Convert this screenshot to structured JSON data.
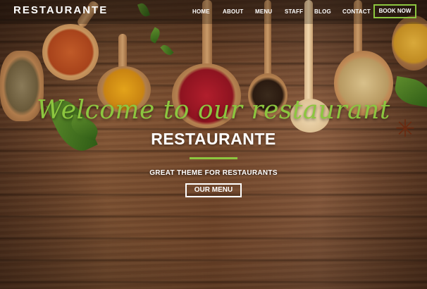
{
  "brand": {
    "logo_text": "RESTAURANTE"
  },
  "nav": {
    "items": [
      {
        "label": "HOME"
      },
      {
        "label": "ABOUT"
      },
      {
        "label": "MENU"
      },
      {
        "label": "STAFF"
      },
      {
        "label": "BLOG"
      },
      {
        "label": "CONTACT"
      }
    ],
    "book_label": "BOOK NOW"
  },
  "hero": {
    "script_heading": "Welcome to our restaurant",
    "title": "RESTAURANTE",
    "subtitle": "GREAT THEME FOR RESTAURANTS",
    "cta_label": "OUR MENU"
  },
  "colors": {
    "accent": "#8cc63f",
    "text": "#ffffff",
    "wood": "#7c4d2f"
  },
  "decor": [
    "wooden-spoon-icon",
    "spice-bowl-icon",
    "peppercorn-icon",
    "basil-leaf-icon",
    "star-anise-icon",
    "rosemary-icon"
  ]
}
